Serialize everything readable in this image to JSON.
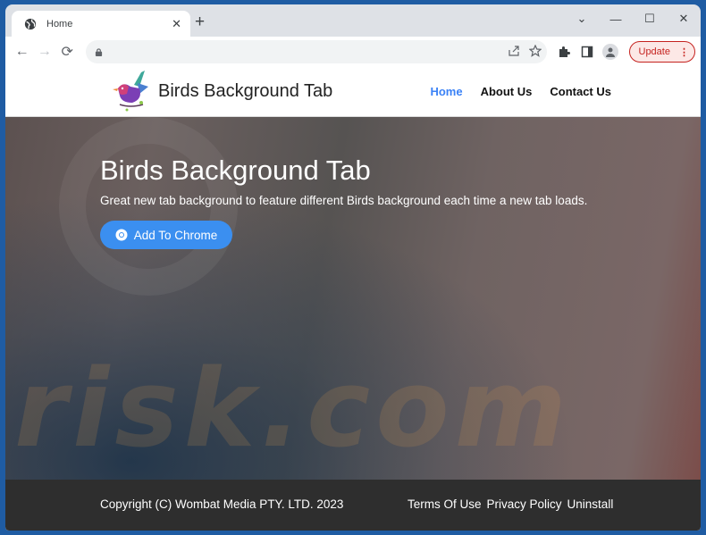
{
  "browser": {
    "tab_title": "Home",
    "new_tab_label": "+",
    "update_label": "Update",
    "omnibox_value": ""
  },
  "header": {
    "brand": "Birds Background Tab",
    "nav": [
      {
        "label": "Home",
        "active": true
      },
      {
        "label": "About Us",
        "active": false
      },
      {
        "label": "Contact Us",
        "active": false
      }
    ]
  },
  "hero": {
    "title": "Birds Background Tab",
    "subtitle": "Great new tab background to feature different Birds background each time a new tab loads.",
    "cta_label": "Add To Chrome",
    "watermark": "risk.com"
  },
  "footer": {
    "copyright": "Copyright (C) Wombat Media PTY. LTD. 2023",
    "links": [
      "Terms Of Use",
      "Privacy Policy",
      "Uninstall"
    ]
  },
  "colors": {
    "accent": "#3b8ff0",
    "nav_active": "#3b82f6",
    "update": "#c5221f",
    "footer_bg": "#2e2e2e"
  }
}
